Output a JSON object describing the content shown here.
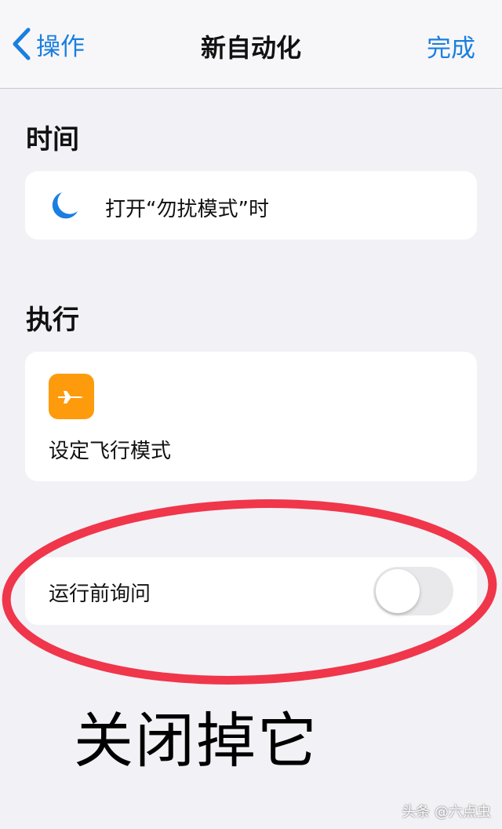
{
  "navbar": {
    "back_label": "操作",
    "title": "新自动化",
    "done_label": "完成"
  },
  "trigger": {
    "section_title": "时间",
    "icon": "moon-icon",
    "text": "打开“勿扰模式”时"
  },
  "action": {
    "section_title": "执行",
    "icon": "airplane-icon",
    "label": "设定飞行模式"
  },
  "ask_before_running": {
    "label": "运行前询问",
    "enabled": false
  },
  "annotation": {
    "text": "关闭掉它"
  },
  "watermark": "头条 @六点虫",
  "colors": {
    "accent": "#1a7fe0",
    "background": "#f2f1f6",
    "airplane_icon_bg": "#fe9b0c",
    "annotation_ellipse": "#f0364a",
    "toggle_off": "#e9e9eb"
  }
}
